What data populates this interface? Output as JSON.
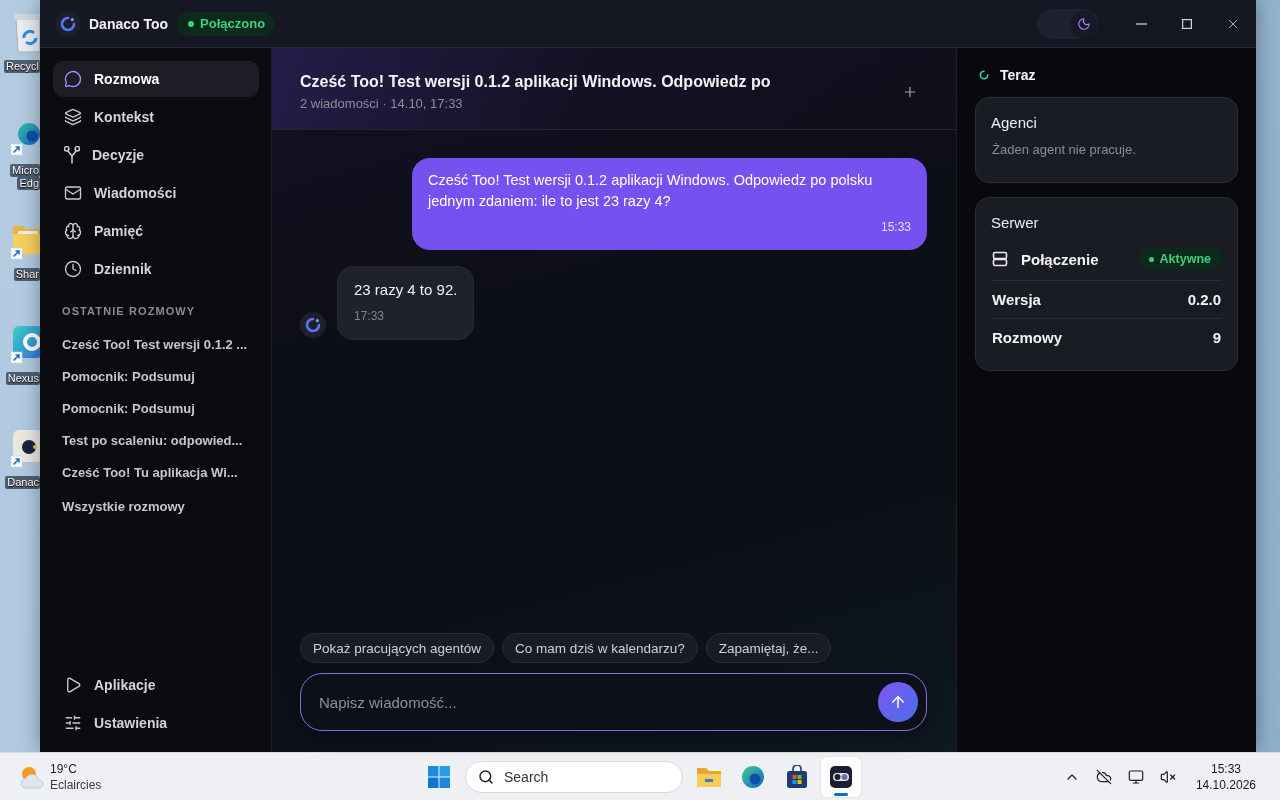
{
  "desktop_icons": [
    {
      "lines": [
        "Recycl"
      ]
    },
    {
      "lines": [
        "Micro",
        "Edg"
      ]
    },
    {
      "lines": [
        "Shar"
      ]
    },
    {
      "lines": [
        "Nexus"
      ]
    },
    {
      "lines": [
        "Danac"
      ]
    }
  ],
  "window": {
    "app_name": "Danaco Too",
    "status": "Połączono",
    "dark_mode": true
  },
  "sidebar": {
    "nav": [
      {
        "label": "Rozmowa",
        "selected": true
      },
      {
        "label": "Kontekst",
        "selected": false
      },
      {
        "label": "Decyzje",
        "selected": false
      },
      {
        "label": "Wiadomości",
        "selected": false
      },
      {
        "label": "Pamięć",
        "selected": false
      },
      {
        "label": "Dziennik",
        "selected": false
      }
    ],
    "recent_heading": "OSTATNIE ROZMOWY",
    "recent": [
      "Cześć Too! Test wersji 0.1.2 ...",
      "Pomocnik: Podsumuj",
      "Pomocnik: Podsumuj",
      "Test po scaleniu: odpowied...",
      "Cześć Too! Tu aplikacja Wi..."
    ],
    "all_link": "Wszystkie rozmowy",
    "bottom_nav": [
      {
        "label": "Aplikacje",
        "selected": false
      },
      {
        "label": "Ustawienia",
        "selected": false
      }
    ]
  },
  "chat": {
    "title": "Cześć Too! Test wersji 0.1.2 aplikacji Windows. Odpowiedz po",
    "subtitle": "2 wiadomości · 14.10, 17:33",
    "messages": [
      {
        "kind": "user",
        "text": "Cześć Too! Test wersji 0.1.2 aplikacji Windows. Odpowiedz po polsku jednym zdaniem: ile to jest 23 razy 4?",
        "time": "15:33"
      },
      {
        "kind": "assistant",
        "text": "23 razy 4 to 92.",
        "time": "17:33"
      }
    ],
    "suggestions": [
      "Pokaż pracujących agentów",
      "Co mam dziś w kalendarzu?",
      "Zapamiętaj, że..."
    ],
    "input": {
      "placeholder": "Napisz wiadomość..."
    }
  },
  "side_panel": {
    "heading": "Teraz",
    "agents": {
      "title": "Agenci",
      "empty_text": "Żaden agent nie pracuje."
    },
    "server": {
      "title": "Serwer",
      "connection": {
        "label": "Połączenie",
        "status": "Aktywne"
      },
      "rows": [
        {
          "label": "Wersja",
          "value": "0.2.0"
        },
        {
          "label": "Rozmowy",
          "value": "9"
        }
      ]
    }
  },
  "taskbar": {
    "weather": {
      "temperature": "19°C",
      "condition": "Eclaircies"
    },
    "search": {
      "placeholder": "Search"
    },
    "apps": [
      {
        "selected": false
      },
      {
        "selected": false
      },
      {
        "selected": false
      },
      {
        "selected": true
      }
    ],
    "clock": {
      "time": "15:33",
      "date": "14.10.2026"
    }
  }
}
